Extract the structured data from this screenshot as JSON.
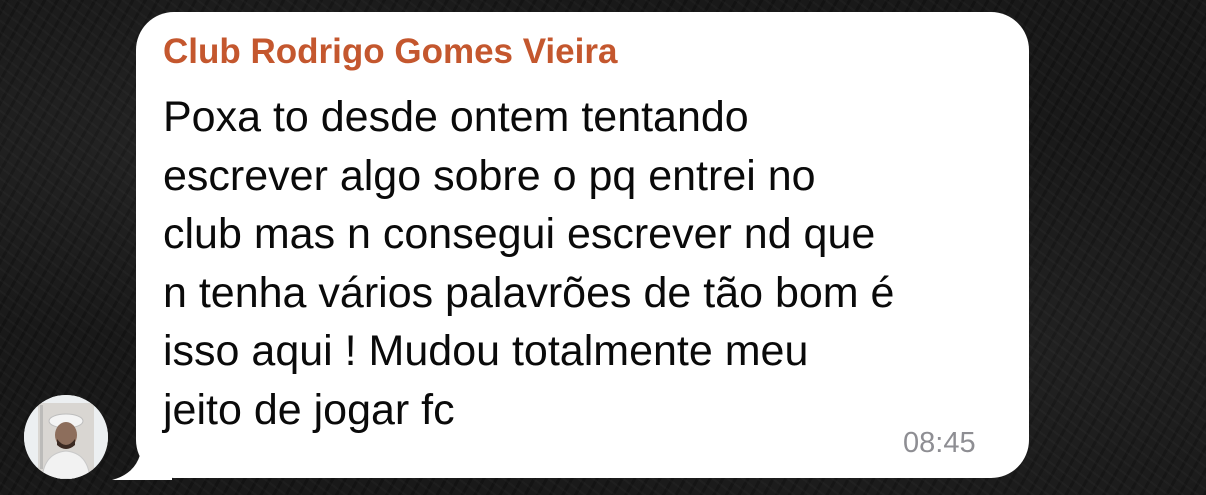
{
  "message": {
    "sender_name": "Club Rodrigo Gomes Vieira",
    "lines": [
      "Poxa to desde ontem tentando",
      "escrever algo sobre o pq entrei no",
      "club mas n consegui escrever nd que",
      "n tenha vários palavrões de tão bom é",
      "isso aqui ! Mudou totalmente meu",
      "jeito de jogar fc"
    ],
    "time": "08:45"
  },
  "colors": {
    "sender_name": "#c4572e",
    "bubble": "#ffffff",
    "timestamp": "#8e8e93"
  }
}
